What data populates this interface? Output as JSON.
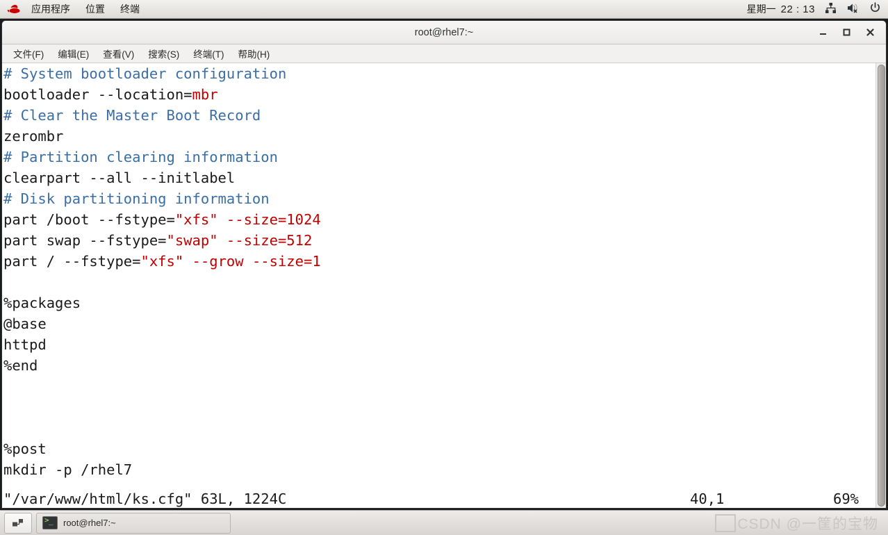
{
  "desktop": {
    "panel": {
      "logo_icon": "redhat-logo-icon",
      "menus": [
        {
          "label": "应用程序",
          "name": "applications-menu"
        },
        {
          "label": "位置",
          "name": "places-menu"
        },
        {
          "label": "终端",
          "name": "terminal-menu"
        }
      ],
      "clock_day": "星期一",
      "clock_time": "22 : 13",
      "tray": [
        {
          "name": "network-icon"
        },
        {
          "name": "volume-muted-icon"
        },
        {
          "name": "power-icon"
        }
      ]
    },
    "taskbar": {
      "workspace_switcher_icon": "workspace-switcher-icon",
      "window_button_label": "root@rhel7:~",
      "watermark": "CSDN @一筐的宝物"
    }
  },
  "window": {
    "title": "root@rhel7:~",
    "controls": {
      "minimize": "minimize-icon",
      "maximize": "maximize-icon",
      "close": "close-icon"
    },
    "menubar": [
      {
        "label": "文件(F)",
        "name": "menu-file"
      },
      {
        "label": "编辑(E)",
        "name": "menu-edit"
      },
      {
        "label": "查看(V)",
        "name": "menu-view"
      },
      {
        "label": "搜索(S)",
        "name": "menu-search"
      },
      {
        "label": "终端(T)",
        "name": "menu-terminal"
      },
      {
        "label": "帮助(H)",
        "name": "menu-help"
      }
    ]
  },
  "editor": {
    "colors": {
      "comment": "#3a6ea5",
      "value": "#c00000",
      "plain": "#1a1a1a",
      "background": "#ffffff"
    },
    "lines": [
      {
        "segments": [
          {
            "t": "# System bootloader configuration",
            "c": "comment"
          }
        ]
      },
      {
        "segments": [
          {
            "t": "bootloader --location=",
            "c": "plain"
          },
          {
            "t": "mbr",
            "c": "value"
          }
        ]
      },
      {
        "segments": [
          {
            "t": "# Clear the Master Boot Record",
            "c": "comment"
          }
        ]
      },
      {
        "segments": [
          {
            "t": "zerombr",
            "c": "plain"
          }
        ]
      },
      {
        "segments": [
          {
            "t": "# Partition clearing information",
            "c": "comment"
          }
        ]
      },
      {
        "segments": [
          {
            "t": "clearpart --all --initlabel",
            "c": "plain"
          }
        ]
      },
      {
        "segments": [
          {
            "t": "# Disk partitioning information",
            "c": "comment"
          }
        ]
      },
      {
        "segments": [
          {
            "t": "part /boot --fstype=",
            "c": "plain"
          },
          {
            "t": "\"xfs\"",
            "c": "value"
          },
          {
            "t": " ",
            "c": "plain"
          },
          {
            "t": "--size=1024",
            "c": "value"
          }
        ]
      },
      {
        "segments": [
          {
            "t": "part swap --fstype=",
            "c": "plain"
          },
          {
            "t": "\"swap\"",
            "c": "value"
          },
          {
            "t": " ",
            "c": "plain"
          },
          {
            "t": "--size=512",
            "c": "value"
          }
        ]
      },
      {
        "segments": [
          {
            "t": "part / --fstype=",
            "c": "plain"
          },
          {
            "t": "\"xfs\"",
            "c": "value"
          },
          {
            "t": " ",
            "c": "plain"
          },
          {
            "t": "--grow --size=1",
            "c": "value"
          }
        ]
      },
      {
        "segments": [
          {
            "t": "",
            "c": "plain"
          }
        ]
      },
      {
        "segments": [
          {
            "t": "%packages",
            "c": "plain"
          }
        ]
      },
      {
        "segments": [
          {
            "t": "@base",
            "c": "plain"
          }
        ]
      },
      {
        "segments": [
          {
            "t": "httpd",
            "c": "plain"
          }
        ]
      },
      {
        "segments": [
          {
            "t": "%end",
            "c": "plain"
          }
        ]
      },
      {
        "segments": [
          {
            "t": "",
            "c": "plain"
          }
        ]
      },
      {
        "segments": [
          {
            "t": "",
            "c": "plain"
          }
        ]
      },
      {
        "segments": [
          {
            "t": "",
            "c": "plain"
          }
        ]
      },
      {
        "segments": [
          {
            "t": "%post",
            "c": "plain"
          }
        ]
      },
      {
        "segments": [
          {
            "t": "mkdir -p /rhel7",
            "c": "plain"
          }
        ]
      }
    ],
    "status": {
      "file": "\"/var/www/html/ks.cfg\" 63L, 1224C",
      "position": "40,1",
      "percent": "69%"
    }
  }
}
